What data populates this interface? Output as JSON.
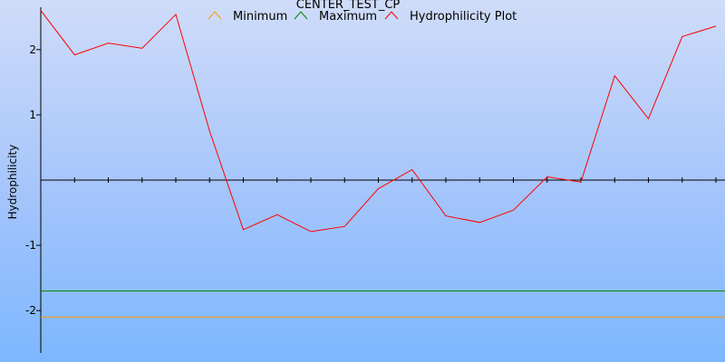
{
  "chart_data": {
    "type": "line",
    "title": "CENTER_TEST_CP",
    "xlabel": "",
    "ylabel": "Hydrophilicity",
    "ylim": [
      -2.65,
      2.65
    ],
    "y_ticks": [
      {
        "value": 2,
        "label": "2"
      },
      {
        "value": 1,
        "label": "1"
      },
      {
        "value": -1,
        "label": "-1"
      },
      {
        "value": -2,
        "label": "-2"
      }
    ],
    "x_tick_count": 20,
    "grid": false,
    "legend_position": "top",
    "series": [
      {
        "name": "Minimum",
        "color": "#ff9900",
        "values": [
          -2.1,
          -2.1
        ]
      },
      {
        "name": "Maximum",
        "color": "#008800",
        "values": [
          -1.7,
          -1.7
        ]
      },
      {
        "name": "Hydrophilicity Plot",
        "color": "#ff0000",
        "values": [
          2.6,
          1.92,
          2.1,
          2.02,
          2.54,
          0.75,
          -0.76,
          -0.53,
          -0.79,
          -0.71,
          -0.13,
          0.16,
          -0.55,
          -0.65,
          -0.46,
          0.05,
          -0.03,
          1.6,
          0.94,
          2.2,
          2.36
        ]
      }
    ]
  }
}
